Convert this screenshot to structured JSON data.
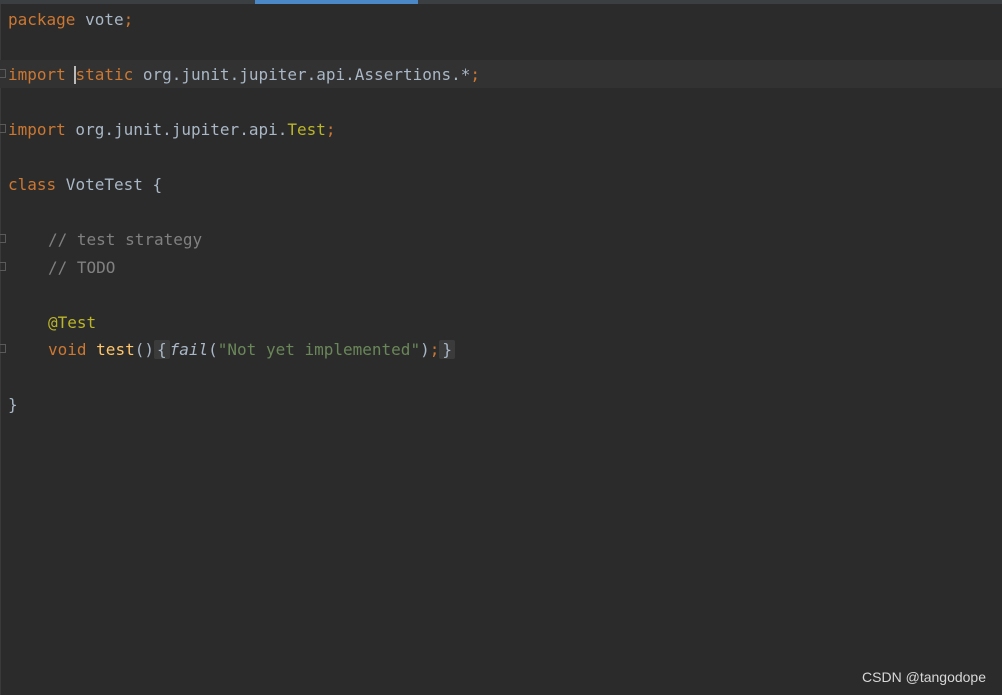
{
  "editor": {
    "lines": {
      "package": {
        "kw": "package",
        "name": " vote",
        "semi": ";"
      },
      "import_static": {
        "kw1": "import",
        "kw2": "static",
        "path": " org.junit.jupiter.api.Assertions.*",
        "semi": ";"
      },
      "import_test": {
        "kw": "import",
        "path": " org.junit.jupiter.api.",
        "cls": "Test",
        "semi": ";"
      },
      "class_decl": {
        "kw": "class",
        "name": " VoteTest {"
      },
      "comment1": "// test strategy",
      "comment2": "// TODO",
      "annotation": "@Test",
      "method": {
        "kw": "void",
        "name": "test",
        "parens": "()",
        "open_brace": "{",
        "call": "fail",
        "paren_open": "(",
        "string": "\"Not yet implemented\"",
        "paren_close": ")",
        "semi": ";",
        "close_brace": "}"
      },
      "class_close": "}"
    }
  },
  "watermark": "CSDN @tangodope",
  "colors": {
    "background": "#2b2b2b",
    "keyword": "#cc7832",
    "annotation": "#bbb529",
    "comment": "#808080",
    "string": "#6a8759",
    "function": "#ffc66d",
    "identifier": "#a9b7c6",
    "tab_accent": "#4a88c7"
  }
}
